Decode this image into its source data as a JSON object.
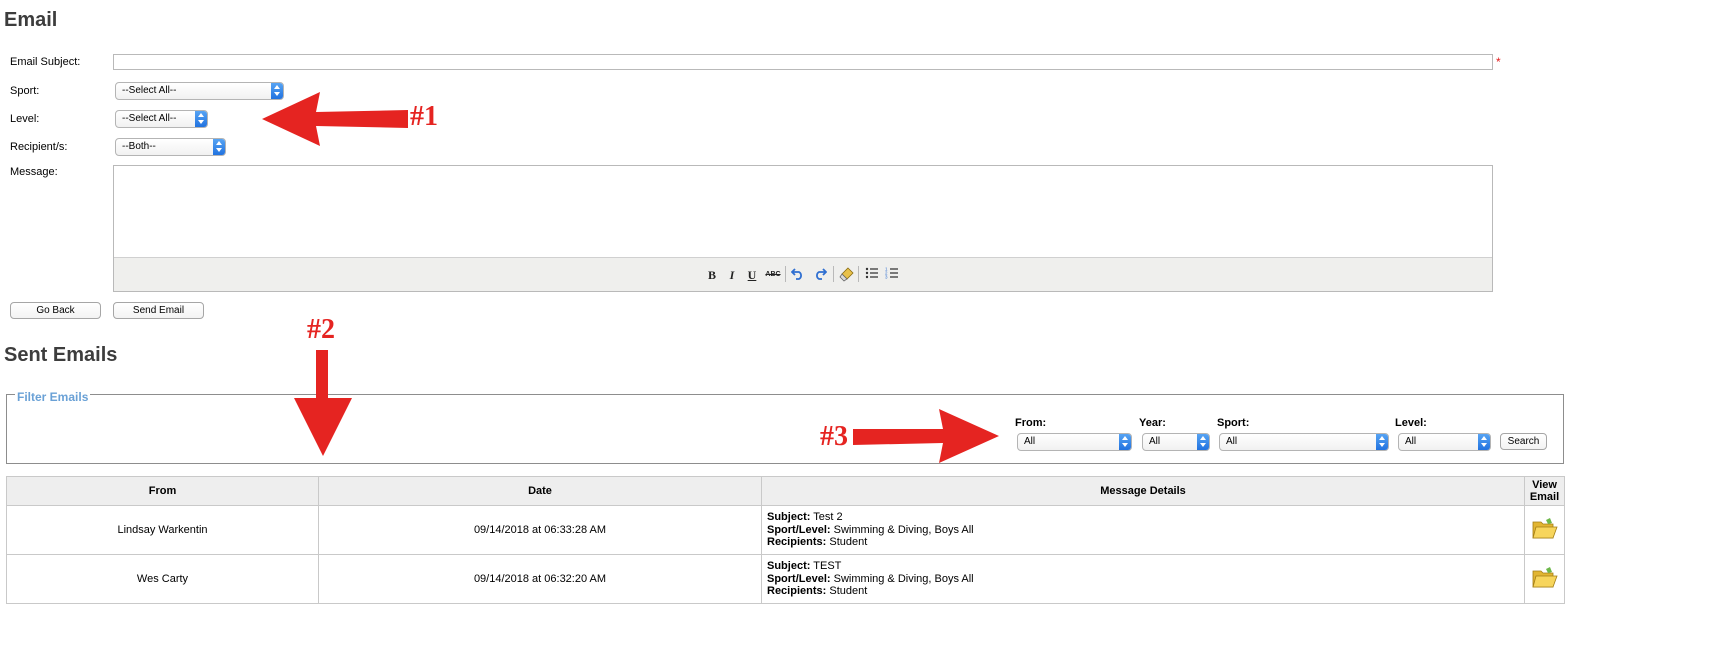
{
  "compose": {
    "title": "Email",
    "subject_label": "Email Subject:",
    "subject_value": "",
    "required_mark": "*",
    "sport_label": "Sport:",
    "sport_value": "--Select All--",
    "level_label": "Level:",
    "level_value": "--Select All--",
    "recipients_label": "Recipient/s:",
    "recipients_value": "--Both--",
    "message_label": "Message:",
    "toolbar": [
      "bold-icon",
      "italic-icon",
      "underline-icon",
      "strikethrough-icon",
      "undo-icon",
      "redo-icon",
      "clear-format-icon",
      "bullet-list-icon",
      "numbered-list-icon"
    ],
    "toolbar_glyphs": {
      "bold": "B",
      "italic": "I",
      "underline": "U",
      "strike": "ABC"
    },
    "go_back_label": "Go Back",
    "send_label": "Send Email"
  },
  "sent": {
    "title": "Sent Emails",
    "filter": {
      "legend": "Filter Emails",
      "from_label": "From:",
      "from_value": "All",
      "year_label": "Year:",
      "year_value": "All",
      "sport_label": "Sport:",
      "sport_value": "All",
      "level_label": "Level:",
      "level_value": "All",
      "search_label": "Search"
    },
    "columns": [
      "From",
      "Date",
      "Message Details",
      "View Email"
    ],
    "rows": [
      {
        "from": "Lindsay Warkentin",
        "date": "09/14/2018 at 06:33:28 AM",
        "subject_key": "Subject:",
        "subject": "Test 2",
        "sport_key": "Sport/Level:",
        "sport_level": "Swimming & Diving, Boys All",
        "recipients_key": "Recipients:",
        "recipients": "Student",
        "view_icon": "folder-icon"
      },
      {
        "from": "Wes Carty",
        "date": "09/14/2018 at 06:32:20 AM",
        "subject_key": "Subject:",
        "subject": "TEST",
        "sport_key": "Sport/Level:",
        "sport_level": "Swimming & Diving, Boys All",
        "recipients_key": "Recipients:",
        "recipients": "Student",
        "view_icon": "folder-icon"
      }
    ]
  },
  "annotations": {
    "a1": "#1",
    "a2": "#2",
    "a3": "#3",
    "color": "#e52421"
  }
}
